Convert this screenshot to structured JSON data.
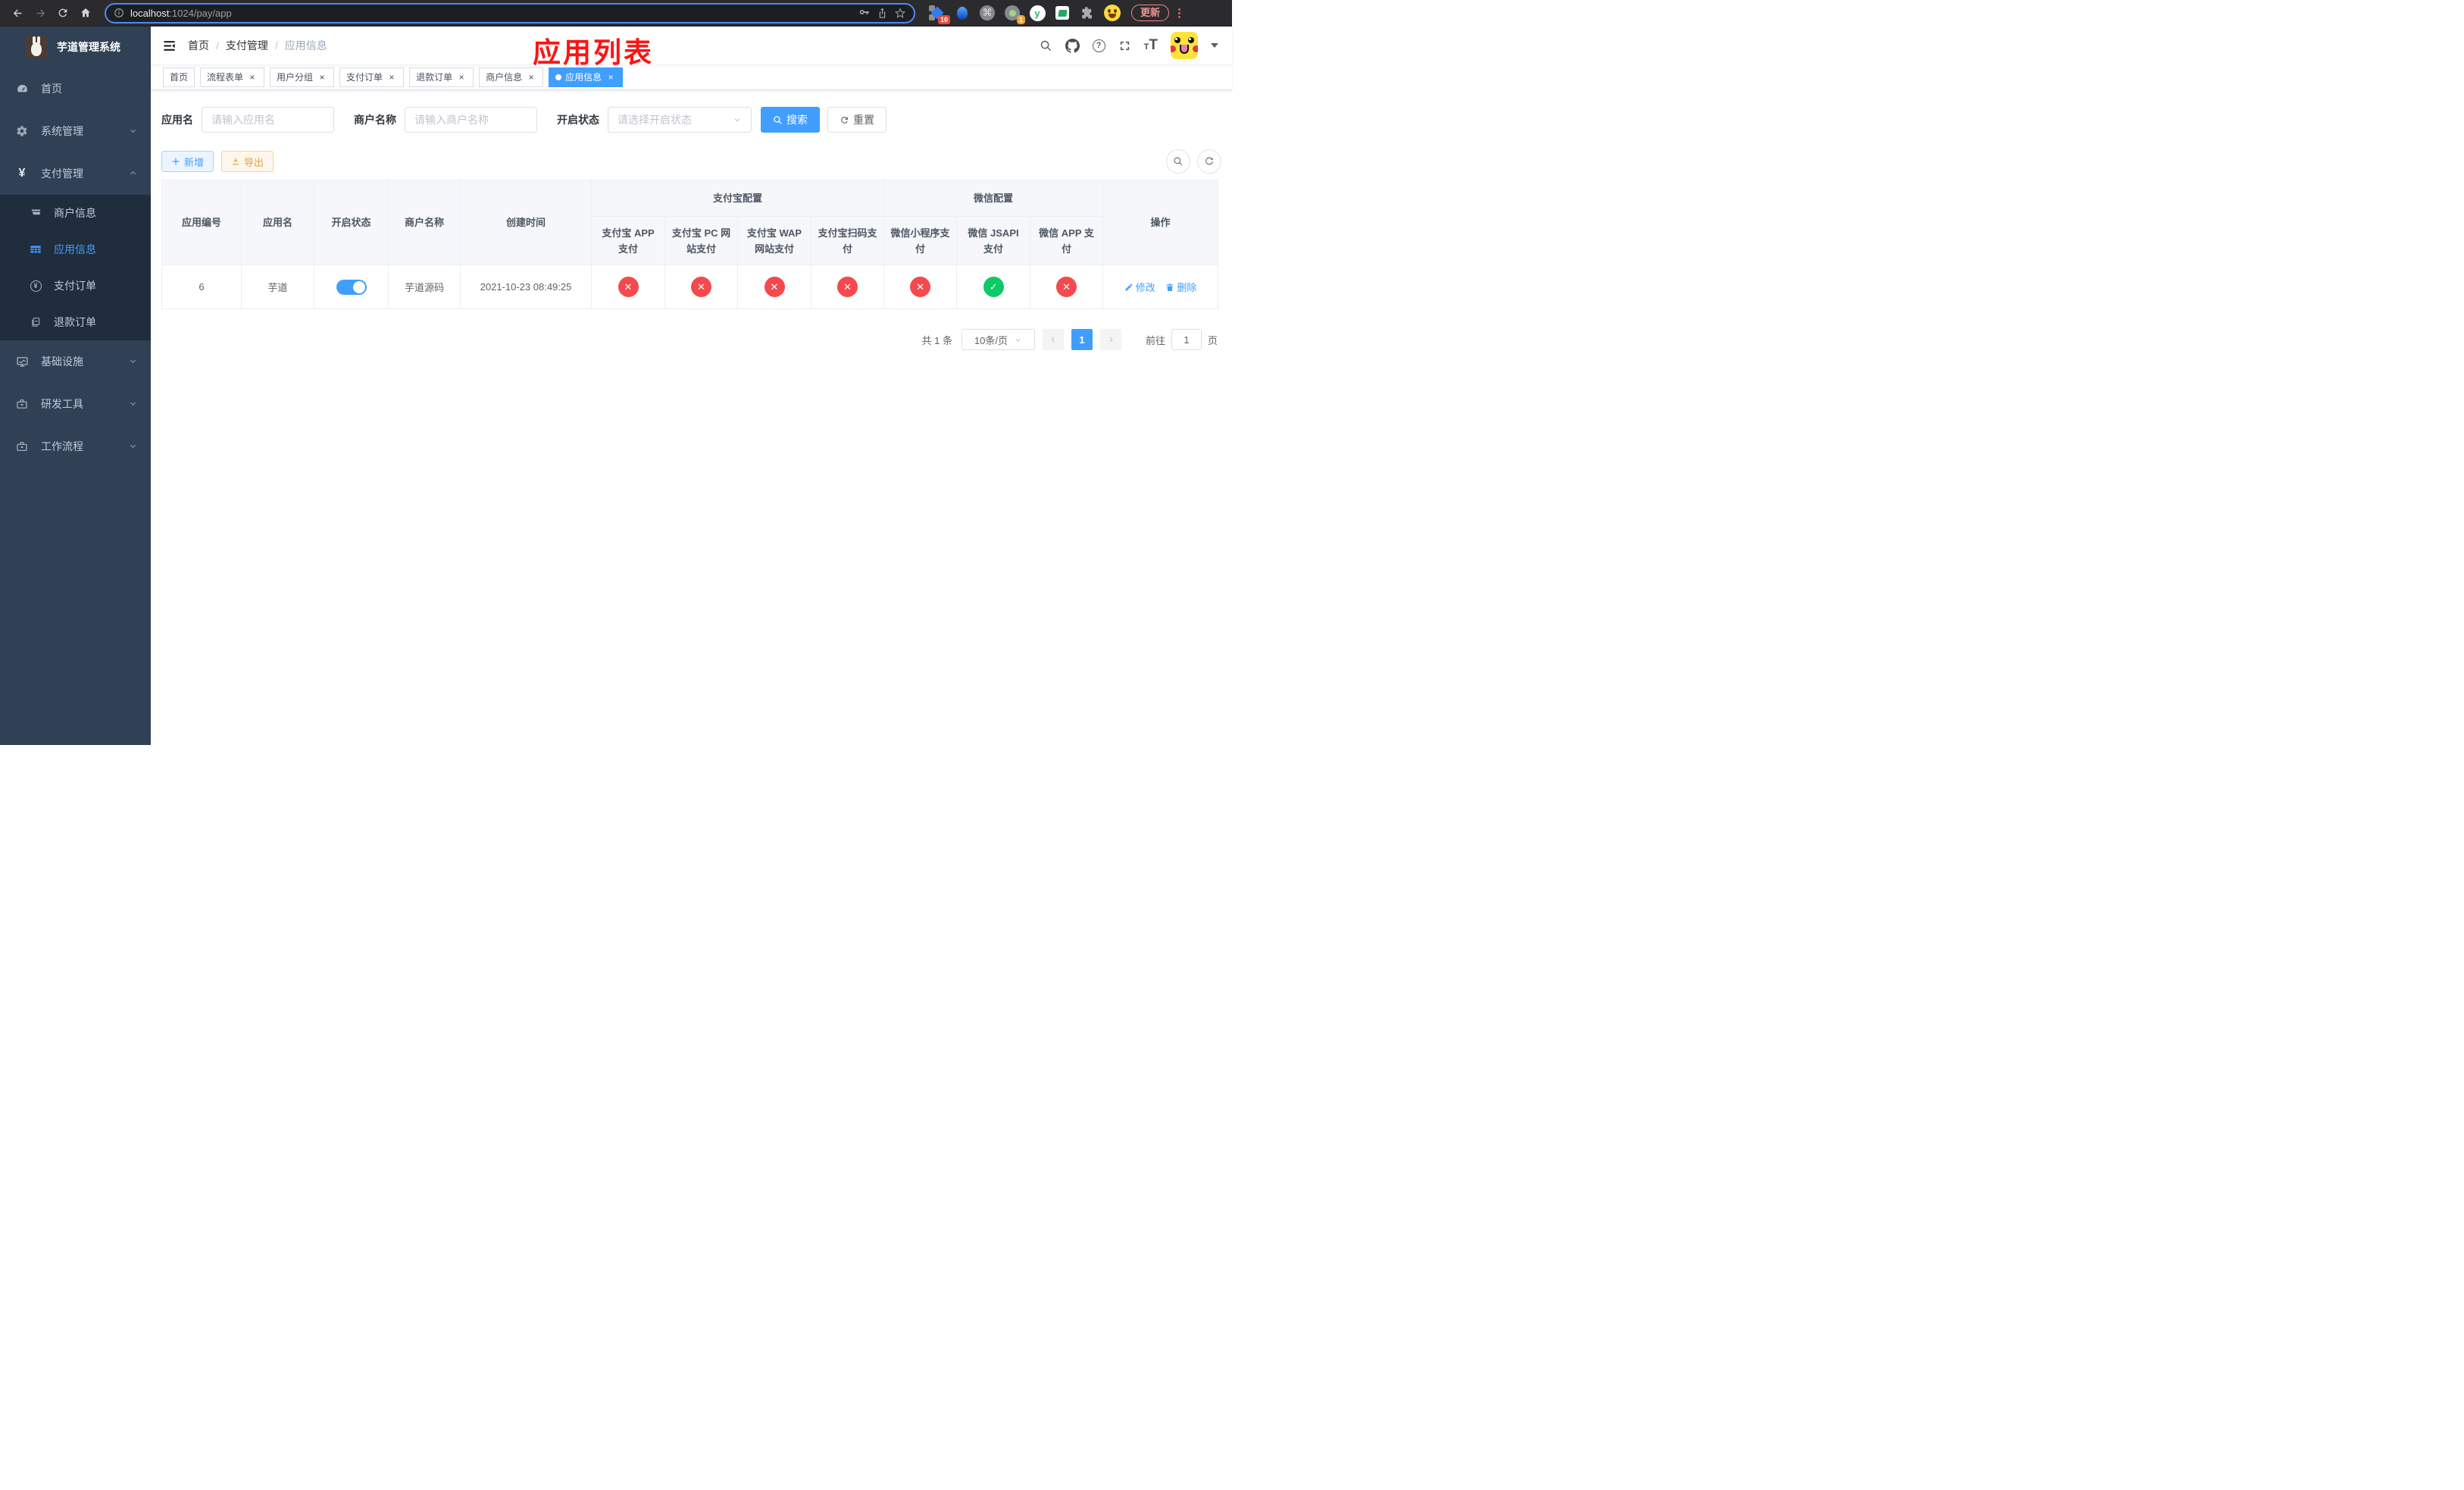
{
  "browser": {
    "url": {
      "host": "localhost",
      "rest": ":1024/pay/app"
    },
    "update_label": "更新",
    "badges": {
      "pinned_ext": "10",
      "notify_ext": "1"
    }
  },
  "icons": {
    "cross": "✕",
    "check": "✓",
    "close": "×",
    "command": "⌘",
    "question": "?",
    "y_logo": "y",
    "t_big": "T",
    "t_small": "T",
    "yen": "¥"
  },
  "sidebar": {
    "title": "芋道管理系统",
    "menu": [
      {
        "label": "首页"
      },
      {
        "label": "系统管理"
      },
      {
        "label": "支付管理"
      }
    ],
    "submenu": [
      {
        "label": "商户信息"
      },
      {
        "label": "应用信息"
      },
      {
        "label": "支付订单"
      },
      {
        "label": "退款订单"
      }
    ],
    "menu2": [
      {
        "label": "基础设施"
      },
      {
        "label": "研发工具"
      },
      {
        "label": "工作流程"
      }
    ]
  },
  "navbar": {
    "breadcrumb": [
      "首页",
      "支付管理",
      "应用信息"
    ],
    "separator": "/",
    "annotation": "应用列表"
  },
  "tabs": [
    {
      "label": "首页"
    },
    {
      "label": "流程表单"
    },
    {
      "label": "用户分组"
    },
    {
      "label": "支付订单"
    },
    {
      "label": "退款订单"
    },
    {
      "label": "商户信息"
    },
    {
      "label": "应用信息"
    }
  ],
  "filters": {
    "app_name": {
      "label": "应用名",
      "placeholder": "请输入应用名",
      "value": ""
    },
    "merchant_name": {
      "label": "商户名称",
      "placeholder": "请输入商户名称",
      "value": ""
    },
    "status": {
      "label": "开启状态",
      "placeholder": "请选择开启状态"
    },
    "search_label": "搜索",
    "reset_label": "重置"
  },
  "toolbar": {
    "add_label": "新增",
    "export_label": "导出"
  },
  "table": {
    "columns": {
      "id": "应用编号",
      "name": "应用名",
      "status": "开启状态",
      "merchant": "商户名称",
      "created": "创建时间",
      "actions": "操作"
    },
    "groups": {
      "alipay": "支付宝配置",
      "wechat": "微信配置"
    },
    "sub_columns": [
      "支付宝 APP 支付",
      "支付宝 PC 网站支付",
      "支付宝 WAP 网站支付",
      "支付宝扫码支付",
      "微信小程序支付",
      "微信 JSAPI 支付",
      "微信 APP 支付"
    ],
    "row": {
      "id": "6",
      "name": "芋道",
      "enabled": true,
      "merchant": "芋道源码",
      "created": "2021-10-23 08:49:25",
      "statuses": [
        "cross",
        "cross",
        "cross",
        "cross",
        "cross",
        "check",
        "cross"
      ],
      "actions": {
        "edit": "修改",
        "delete": "删除"
      }
    }
  },
  "pagination": {
    "total": "共 1 条",
    "page_size": "10条/页",
    "page": "1",
    "goto_label": "前往",
    "goto_value": "1",
    "page_unit": "页"
  },
  "colors": {
    "primary": "#409eff",
    "danger": "#f5494d",
    "success": "#0fc966",
    "warning": "#e6a23c",
    "sidebar_bg": "#304156",
    "submenu_bg": "#1f2d3d",
    "annotation_red": "#fb1515"
  }
}
